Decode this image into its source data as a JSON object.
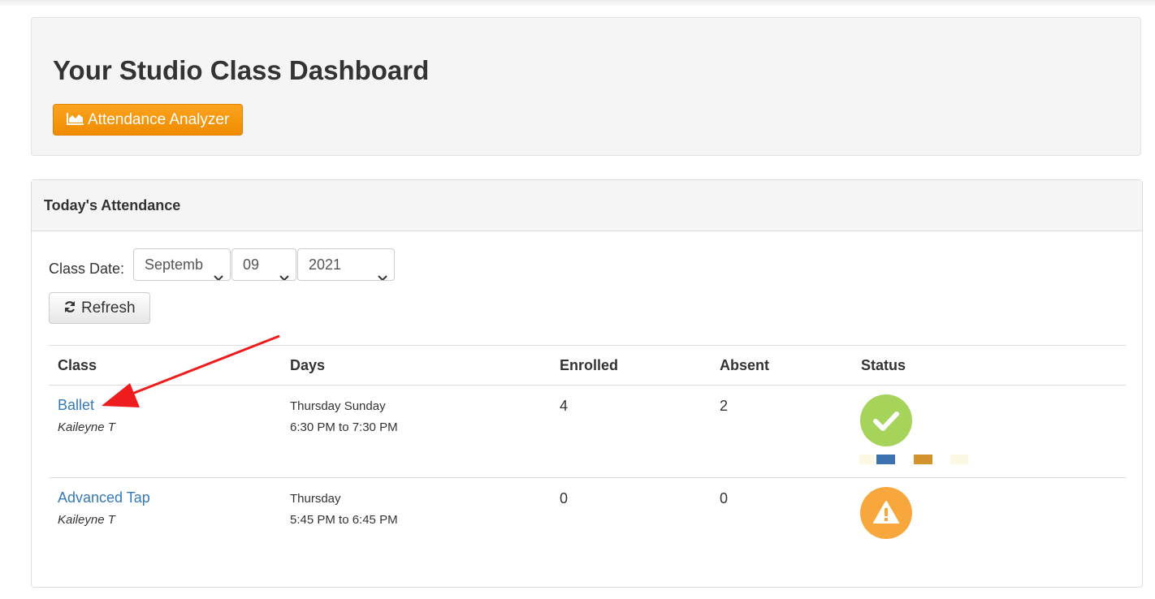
{
  "header": {
    "title": "Your Studio Class Dashboard",
    "analyzer_button": "Attendance Analyzer"
  },
  "panel": {
    "title": "Today's Attendance",
    "date_label": "Class Date:",
    "month_value": "Septemb",
    "day_value": "09",
    "year_value": "2021",
    "refresh_label": "Refresh"
  },
  "table": {
    "headers": [
      "Class",
      "Days",
      "Enrolled",
      "Absent",
      "Status"
    ],
    "rows": [
      {
        "class_name": "Ballet",
        "instructor": "Kaileyne T",
        "days": "Thursday Sunday",
        "time": "6:30 PM to 7:30 PM",
        "enrolled": "4",
        "absent": "2",
        "status_icon": "check-icon",
        "status_color": "#a6d35a"
      },
      {
        "class_name": "Advanced Tap",
        "instructor": "Kaileyne T",
        "days": "Thursday",
        "time": "5:45 PM to 6:45 PM",
        "enrolled": "0",
        "absent": "0",
        "status_icon": "warning-icon",
        "status_color": "#f8a73d"
      }
    ]
  },
  "colors": {
    "accent_orange": "#f39a14",
    "link_blue": "#337ab7",
    "annotation_arrow": "#ee1c1c",
    "swatch_blue": "#3d72b0",
    "swatch_orange": "#d4922d",
    "swatch_cream": "#fbf9e3"
  }
}
